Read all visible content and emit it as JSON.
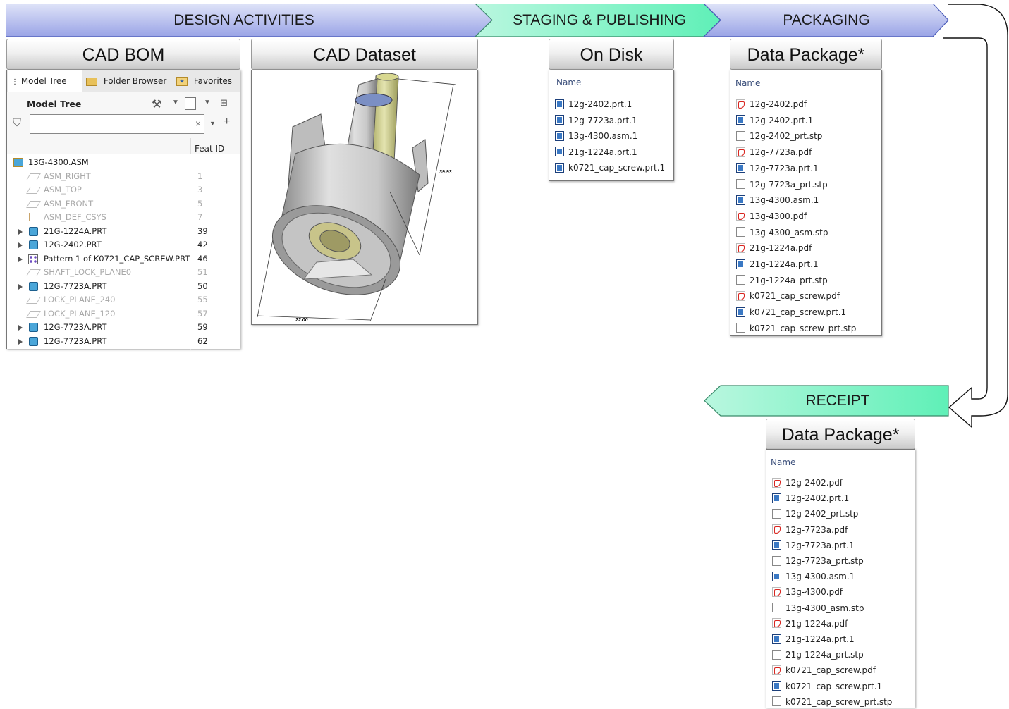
{
  "banners": {
    "design": "DESIGN ACTIVITIES",
    "staging": "STAGING & PUBLISHING",
    "packaging": "PACKAGING",
    "receipt": "RECEIPT"
  },
  "colors": {
    "banner_blue": "#aab3ea",
    "banner_green": "#7ff5c8",
    "panel_border": "#777777"
  },
  "cad_bom": {
    "title": "CAD BOM",
    "tabs": [
      "Model Tree",
      "Folder Browser",
      "Favorites"
    ],
    "toolbar_label": "Model Tree",
    "filter_placeholder": "",
    "filter_clear": "×",
    "column_feat_id": "Feat ID",
    "root": "13G-4300.ASM",
    "rows": [
      {
        "name": "ASM_RIGHT",
        "fid": "1",
        "kind": "plane"
      },
      {
        "name": "ASM_TOP",
        "fid": "3",
        "kind": "plane"
      },
      {
        "name": "ASM_FRONT",
        "fid": "5",
        "kind": "plane"
      },
      {
        "name": "ASM_DEF_CSYS",
        "fid": "7",
        "kind": "csys"
      },
      {
        "name": "21G-1224A.PRT",
        "fid": "39",
        "kind": "part"
      },
      {
        "name": "12G-2402.PRT",
        "fid": "42",
        "kind": "part"
      },
      {
        "name": "Pattern 1 of K0721_CAP_SCREW.PRT",
        "fid": "46",
        "kind": "pattern"
      },
      {
        "name": "SHAFT_LOCK_PLANE0",
        "fid": "51",
        "kind": "plane"
      },
      {
        "name": "12G-7723A.PRT",
        "fid": "50",
        "kind": "part"
      },
      {
        "name": "LOCK_PLANE_240",
        "fid": "55",
        "kind": "plane"
      },
      {
        "name": "LOCK_PLANE_120",
        "fid": "57",
        "kind": "plane"
      },
      {
        "name": "12G-7723A.PRT",
        "fid": "59",
        "kind": "part"
      },
      {
        "name": "12G-7723A.PRT",
        "fid": "62",
        "kind": "part"
      }
    ]
  },
  "cad_dataset": {
    "title": "CAD Dataset",
    "dim_height": "39.93",
    "dim_width": "22.00"
  },
  "on_disk": {
    "title": "On Disk",
    "column": "Name",
    "files": [
      {
        "name": "12g-2402.prt.1",
        "type": "prt"
      },
      {
        "name": "12g-7723a.prt.1",
        "type": "prt"
      },
      {
        "name": "13g-4300.asm.1",
        "type": "prt"
      },
      {
        "name": "21g-1224a.prt.1",
        "type": "prt"
      },
      {
        "name": "k0721_cap_screw.prt.1",
        "type": "prt"
      }
    ]
  },
  "data_package": {
    "title": "Data Package*",
    "column": "Name",
    "files": [
      {
        "name": "12g-2402.pdf",
        "type": "pdf"
      },
      {
        "name": "12g-2402.prt.1",
        "type": "prt"
      },
      {
        "name": "12g-2402_prt.stp",
        "type": "stp"
      },
      {
        "name": "12g-7723a.pdf",
        "type": "pdf"
      },
      {
        "name": "12g-7723a.prt.1",
        "type": "prt"
      },
      {
        "name": "12g-7723a_prt.stp",
        "type": "stp"
      },
      {
        "name": "13g-4300.asm.1",
        "type": "prt"
      },
      {
        "name": "13g-4300.pdf",
        "type": "pdf"
      },
      {
        "name": "13g-4300_asm.stp",
        "type": "stp"
      },
      {
        "name": "21g-1224a.pdf",
        "type": "pdf"
      },
      {
        "name": "21g-1224a.prt.1",
        "type": "prt"
      },
      {
        "name": "21g-1224a_prt.stp",
        "type": "stp"
      },
      {
        "name": "k0721_cap_screw.pdf",
        "type": "pdf"
      },
      {
        "name": "k0721_cap_screw.prt.1",
        "type": "prt"
      },
      {
        "name": "k0721_cap_screw_prt.stp",
        "type": "stp"
      }
    ]
  },
  "receipt_package": {
    "title": "Data Package*",
    "column": "Name",
    "files": [
      {
        "name": "12g-2402.pdf",
        "type": "pdf"
      },
      {
        "name": "12g-2402.prt.1",
        "type": "prt"
      },
      {
        "name": "12g-2402_prt.stp",
        "type": "stp"
      },
      {
        "name": "12g-7723a.pdf",
        "type": "pdf"
      },
      {
        "name": "12g-7723a.prt.1",
        "type": "prt"
      },
      {
        "name": "12g-7723a_prt.stp",
        "type": "stp"
      },
      {
        "name": "13g-4300.asm.1",
        "type": "prt"
      },
      {
        "name": "13g-4300.pdf",
        "type": "pdf"
      },
      {
        "name": "13g-4300_asm.stp",
        "type": "stp"
      },
      {
        "name": "21g-1224a.pdf",
        "type": "pdf"
      },
      {
        "name": "21g-1224a.prt.1",
        "type": "prt"
      },
      {
        "name": "21g-1224a_prt.stp",
        "type": "stp"
      },
      {
        "name": "k0721_cap_screw.pdf",
        "type": "pdf"
      },
      {
        "name": "k0721_cap_screw.prt.1",
        "type": "prt"
      },
      {
        "name": "k0721_cap_screw_prt.stp",
        "type": "stp"
      }
    ]
  }
}
